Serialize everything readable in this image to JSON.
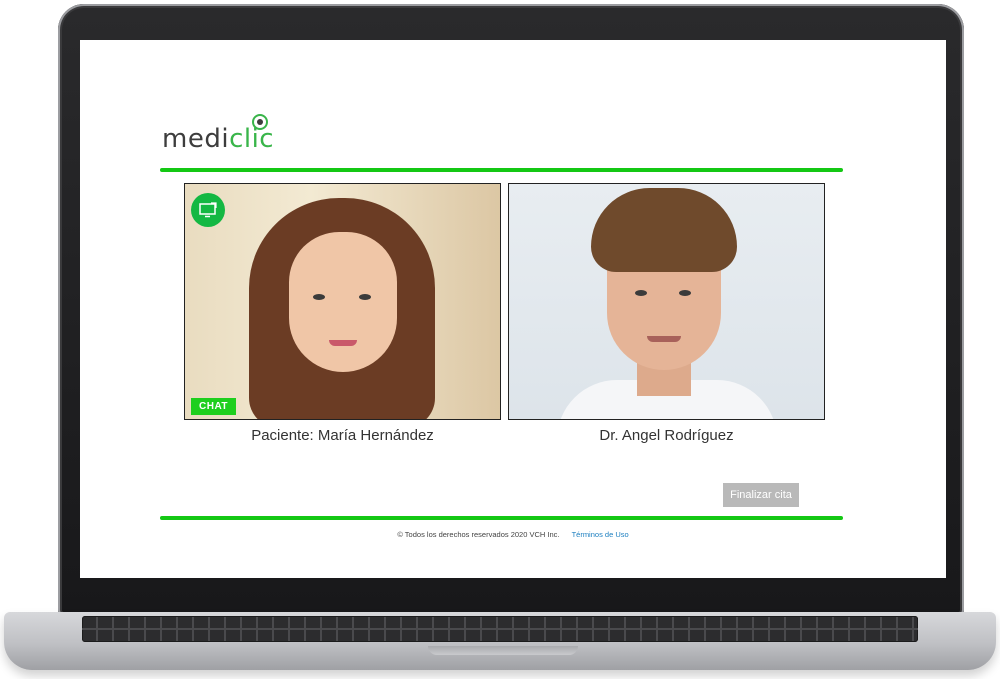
{
  "app": {
    "logo_text_main": "medi",
    "logo_text_accent": "clic",
    "brand_color": "#14c814",
    "accent_color": "#39b54a"
  },
  "call": {
    "patient_label": "Paciente: María Hernández",
    "doctor_label": "Dr. Angel Rodríguez",
    "chat_label": "CHAT",
    "screen_share_icon": "screen-share-icon",
    "end_call_label": "Finalizar cita"
  },
  "footer": {
    "copyright": "© Todos los derechos reservados 2020 VCH Inc.",
    "terms_link": "Términos de Uso"
  }
}
